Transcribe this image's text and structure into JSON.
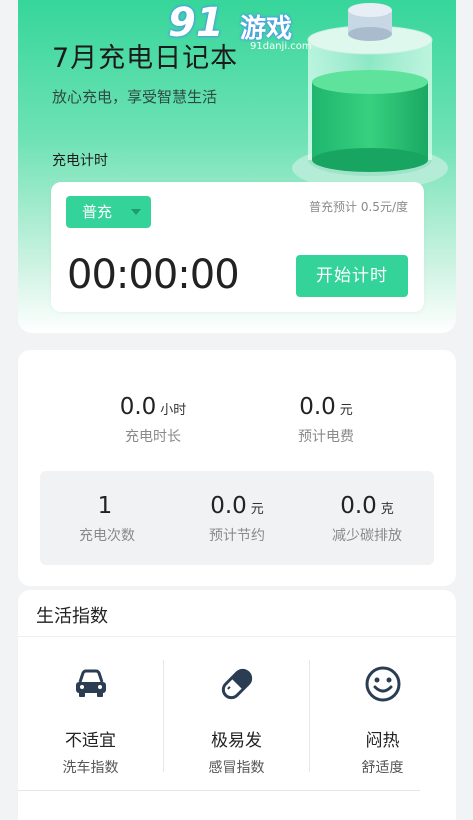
{
  "header": {
    "title": "7月充电日记本",
    "subtitle": "放心充电，享受智慧生活",
    "watermark": {
      "number": "91",
      "text": "游戏",
      "url": "91danji.com"
    }
  },
  "timer": {
    "section_label": "充电计时",
    "mode_selected": "普充",
    "rate_text": "普充预计 0.5元/度",
    "display": "00:00:00",
    "start_label": "开始计时"
  },
  "stats": {
    "primary": [
      {
        "value": "0.0",
        "unit": "小时",
        "label": "充电时长"
      },
      {
        "value": "0.0",
        "unit": "元",
        "label": "预计电费"
      }
    ],
    "secondary": [
      {
        "value": "1",
        "unit": "",
        "label": "充电次数"
      },
      {
        "value": "0.0",
        "unit": "元",
        "label": "预计节约"
      },
      {
        "value": "0.0",
        "unit": "克",
        "label": "减少碳排放"
      }
    ]
  },
  "life": {
    "title": "生活指数",
    "items": [
      {
        "icon": "car-icon",
        "value": "不适宜",
        "label": "洗车指数"
      },
      {
        "icon": "pill-icon",
        "value": "极易发",
        "label": "感冒指数"
      },
      {
        "icon": "smiley-icon",
        "value": "闷热",
        "label": "舒适度"
      }
    ]
  },
  "colors": {
    "accent": "#33d39a",
    "hero_top": "#36d69b",
    "icon_dark": "#2a3d52"
  }
}
